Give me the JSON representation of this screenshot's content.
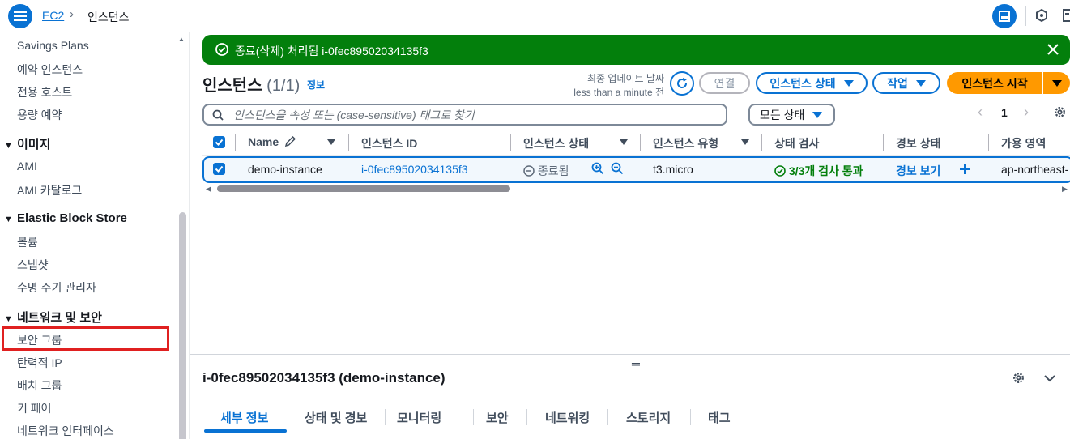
{
  "breadcrumb": {
    "root": "EC2",
    "current": "인스턴스"
  },
  "sidebar": {
    "items_top": [
      "Savings Plans",
      "예약 인스턴스",
      "전용 호스트",
      "용량 예약"
    ],
    "sections": [
      {
        "title": "이미지",
        "items": [
          "AMI",
          "AMI 카탈로그"
        ]
      },
      {
        "title": "Elastic Block Store",
        "items": [
          "볼륨",
          "스냅샷",
          "수명 주기 관리자"
        ]
      },
      {
        "title": "네트워크 및 보안",
        "items": [
          "보안 그룹",
          "탄력적 IP",
          "배치 그룹",
          "키 페어",
          "네트워크 인터페이스"
        ]
      }
    ]
  },
  "flash": {
    "message": "종료(삭제) 처리됨 i-0fec89502034135f3",
    "status_color": "#037f0c"
  },
  "header": {
    "title": "인스턴스",
    "count": "(1/1)",
    "info": "정보",
    "last_updated_label": "최종 업데이트 날짜",
    "last_updated_value": "less than a minute 전",
    "connect_label": "연결",
    "state_label": "인스턴스 상태",
    "actions_label": "작업",
    "launch_label": "인스턴스 시작"
  },
  "search": {
    "placeholder": "인스턴스을 속성 또는 (case-sensitive) 태그로 찾기"
  },
  "filter": {
    "selected": "모든 상태"
  },
  "pagination": {
    "current": "1"
  },
  "table": {
    "headers": [
      "Name",
      "인스턴스 ID",
      "인스턴스 상태",
      "인스턴스 유형",
      "상태 검사",
      "경보 상태",
      "가용 영역"
    ],
    "rows": [
      {
        "name": "demo-instance",
        "instance_id": "i-0fec89502034135f3",
        "state": "종료됨",
        "type": "t3.micro",
        "status_check": "3/3개 검사 통과",
        "alarm": "경보 보기",
        "az": "ap-northeast-"
      }
    ]
  },
  "detail": {
    "title": "i-0fec89502034135f3 (demo-instance)",
    "tabs": [
      "세부 정보",
      "상태 및 경보",
      "모니터링",
      "보안",
      "네트워킹",
      "스토리지",
      "태그"
    ],
    "active_tab": 0
  },
  "colors": {
    "accent": "#0972d3",
    "primary": "#ff9900",
    "success": "#037f0c",
    "highlight": "#e02020"
  }
}
